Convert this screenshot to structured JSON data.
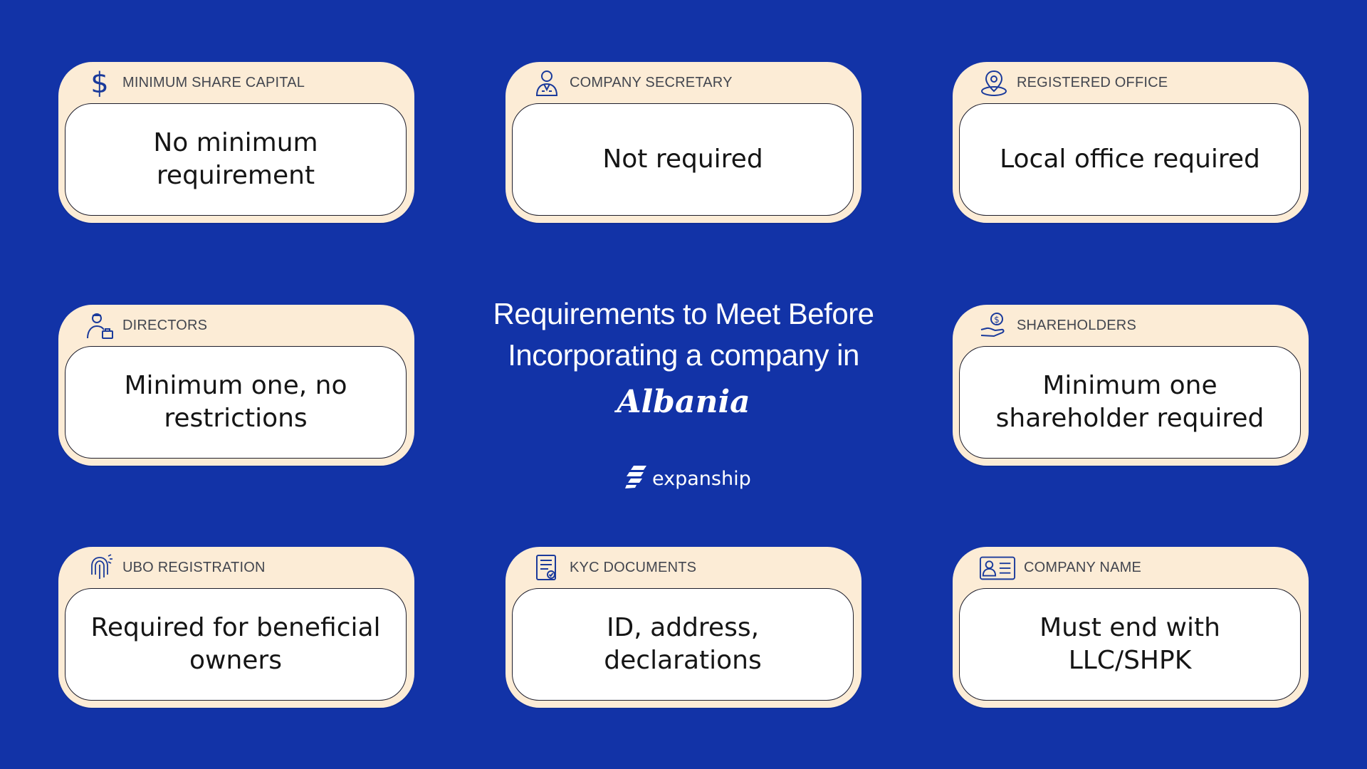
{
  "title": {
    "line1": "Requirements to Meet Before",
    "line2": "Incorporating a company in",
    "country": "Albania"
  },
  "brand": {
    "name": "expanship"
  },
  "colors": {
    "background": "#1233a7",
    "card": "#fcecd6",
    "icon": "#1a3a9b"
  },
  "cards": [
    {
      "label": "MINIMUM SHARE CAPITAL",
      "value": "No minimum requirement",
      "icon": "dollar-icon"
    },
    {
      "label": "COMPANY SECRETARY",
      "value": "Not required",
      "icon": "secretary-icon"
    },
    {
      "label": "REGISTERED OFFICE",
      "value": "Local office required",
      "icon": "location-pin-icon"
    },
    {
      "label": "DIRECTORS",
      "value": "Minimum one, no restrictions",
      "icon": "director-icon"
    },
    {
      "label": "SHAREHOLDERS",
      "value": "Minimum one shareholder required",
      "icon": "hand-coin-icon"
    },
    {
      "label": "UBO REGISTRATION",
      "value": "Required for beneficial owners",
      "icon": "thumbprint-icon"
    },
    {
      "label": "KYC DOCUMENTS",
      "value": "ID, address, declarations",
      "icon": "document-icon"
    },
    {
      "label": "COMPANY NAME",
      "value": "Must end with LLC/SHPK",
      "icon": "id-card-icon"
    }
  ]
}
